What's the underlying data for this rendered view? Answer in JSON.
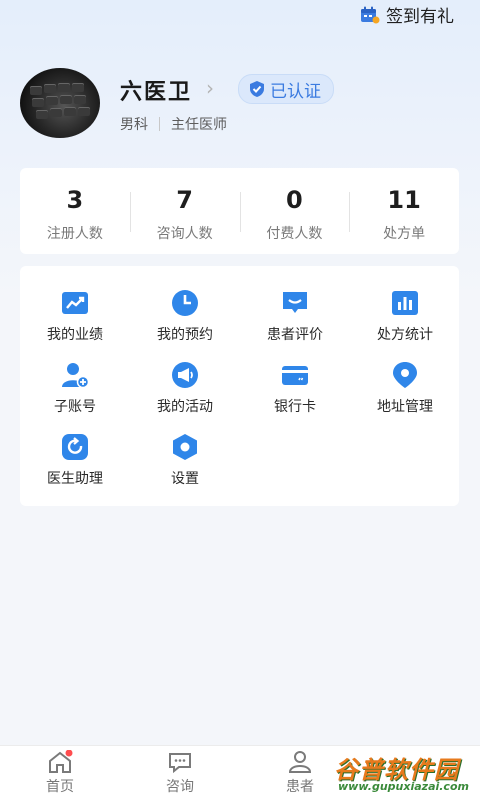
{
  "header": {
    "checkin_label": "签到有礼"
  },
  "profile": {
    "name": "六医卫",
    "verified_label": "已认证",
    "gender": "男科",
    "title": "主任医师"
  },
  "stats": [
    {
      "value": "3",
      "label": "注册人数"
    },
    {
      "value": "7",
      "label": "咨询人数"
    },
    {
      "value": "0",
      "label": "付费人数"
    },
    {
      "value": "11",
      "label": "处方单"
    }
  ],
  "menu": [
    {
      "label": "我的业绩",
      "icon": "trend-chart-icon"
    },
    {
      "label": "我的预约",
      "icon": "clock-icon"
    },
    {
      "label": "患者评价",
      "icon": "chat-bubble-icon"
    },
    {
      "label": "处方统计",
      "icon": "bar-chart-icon"
    },
    {
      "label": "子账号",
      "icon": "sub-account-icon"
    },
    {
      "label": "我的活动",
      "icon": "megaphone-icon"
    },
    {
      "label": "银行卡",
      "icon": "bank-card-icon"
    },
    {
      "label": "地址管理",
      "icon": "location-pin-icon"
    },
    {
      "label": "医生助理",
      "icon": "refresh-assistant-icon"
    },
    {
      "label": "设置",
      "icon": "settings-hexagon-icon"
    }
  ],
  "tabbar": [
    {
      "label": "首页",
      "icon": "home-icon"
    },
    {
      "label": "咨询",
      "icon": "consult-icon"
    },
    {
      "label": "患者",
      "icon": "patient-icon"
    }
  ],
  "watermark": {
    "title": "谷普软件园",
    "url": "www.gupuxiazai.com"
  },
  "colors": {
    "accent": "#3b7be0",
    "badge": "#ff4d4f",
    "menu_icon": "#2f86e9"
  }
}
